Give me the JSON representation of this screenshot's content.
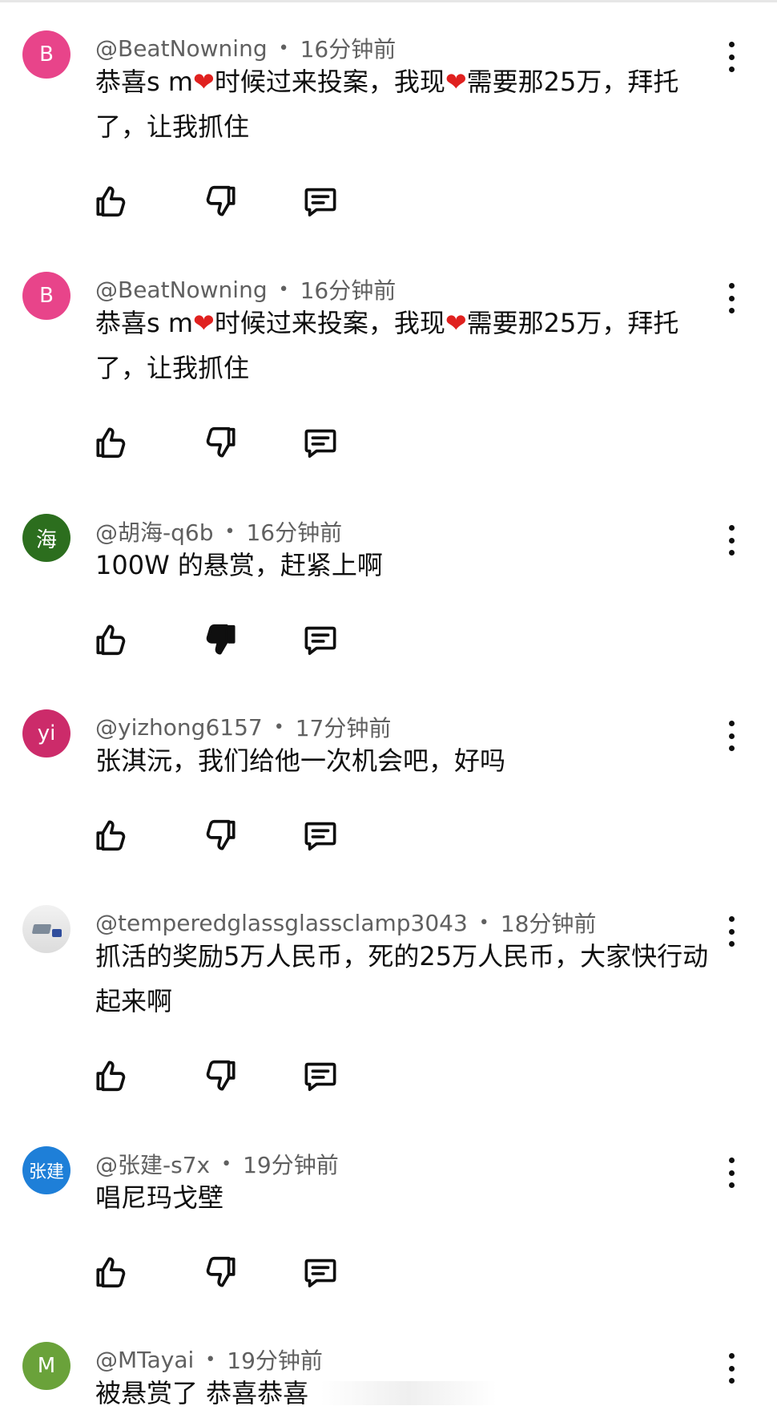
{
  "colors": {
    "avatar_b": "#e8448a",
    "avatar_hai": "#2c6e1e",
    "avatar_yi": "#cc2b6a",
    "avatar_zhangjian": "#1e7fd8",
    "avatar_m": "#6aa23a",
    "heart": "#e0211f",
    "meta_text": "#606060"
  },
  "comments": [
    {
      "avatar_letter": "B",
      "user": "@BeatNowning",
      "dot": "•",
      "time": "16分钟前",
      "text_a": "恭喜s m",
      "heart_1": "❤",
      "text_b": "时候过来投案，我现",
      "heart_2": "❤",
      "text_c": "需要那25万，拜托了，让我抓住",
      "disliked": false
    },
    {
      "avatar_letter": "B",
      "user": "@BeatNowning",
      "dot": "•",
      "time": "16分钟前",
      "text_a": "恭喜s m",
      "heart_1": "❤",
      "text_b": "时候过来投案，我现",
      "heart_2": "❤",
      "text_c": "需要那25万，拜托了，让我抓住",
      "disliked": false
    },
    {
      "avatar_letter": "海",
      "user": "@胡海-q6b",
      "dot": "•",
      "time": "16分钟前",
      "text": "100W 的悬赏，赶紧上啊",
      "disliked": true
    },
    {
      "avatar_letter": "yi",
      "user": "@yizhong6157",
      "dot": "•",
      "time": "17分钟前",
      "text": "张淇沅，我们给他一次机会吧，好吗",
      "disliked": false
    },
    {
      "avatar_letter": "",
      "user": "@temperedglassglassclamp3043",
      "dot": "•",
      "time": "18分钟前",
      "text": "抓活的奖励5万人民币，死的25万人民币，大家快行动起来啊",
      "disliked": false
    },
    {
      "avatar_letter": "张建",
      "user": "@张建-s7x",
      "dot": "•",
      "time": "19分钟前",
      "text": "唱尼玛戈壁",
      "disliked": false
    },
    {
      "avatar_letter": "M",
      "user": "@MTayai",
      "dot": "•",
      "time": "19分钟前",
      "text": "被悬赏了 恭喜恭喜",
      "disliked": false
    }
  ],
  "icons": {
    "like": "thumb-up-icon",
    "dislike": "thumb-down-icon",
    "reply": "comment-icon",
    "more": "more-vert-icon"
  }
}
